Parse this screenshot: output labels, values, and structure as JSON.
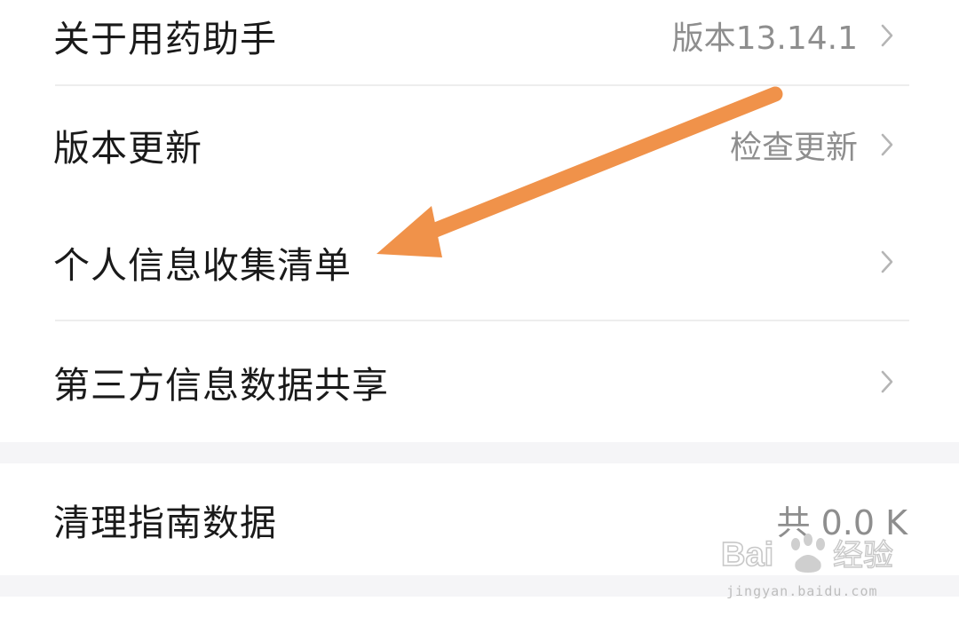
{
  "settings": {
    "about": {
      "label": "关于用药助手",
      "value": "版本13.14.1"
    },
    "update": {
      "label": "版本更新",
      "value": "检查更新"
    },
    "personal_info": {
      "label": "个人信息收集清单"
    },
    "third_party": {
      "label": "第三方信息数据共享"
    },
    "clear_data": {
      "label": "清理指南数据",
      "value": "共 0.0 K"
    }
  },
  "annotation": {
    "arrow_color": "#F0924A"
  },
  "watermark": {
    "brand": "Bai经验",
    "domain": "jingyan.baidu.com"
  },
  "colors": {
    "text": "#1a1a1a",
    "secondary": "#8e8e8e",
    "divider": "#ededed",
    "section_bg": "#f5f5f7"
  }
}
